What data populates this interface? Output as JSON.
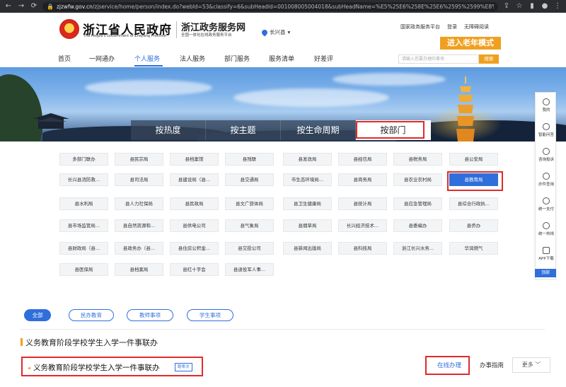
{
  "browser": {
    "url_host": "zjzwfw.gov.cn",
    "url_rest": "/zjservice/home/person/index.do?webId=53&classify=6&subHeadId=001008005004018&subHeadName=%E5%25E6%258E%25E6%2595%2599%E8%2582%25..."
  },
  "header": {
    "gov_title": "浙江省人民政府",
    "gov_subtitle": "The People's Government of Zhejiang Province",
    "svc_title": "浙江政务服务网",
    "svc_subtitle": "全国一体化在线政务服务平台",
    "region": "长兴县",
    "top_links": [
      "国家政务服务平台",
      "登录",
      "无障碍阅读"
    ],
    "elder_mode": "进入老年模式"
  },
  "nav": {
    "items": [
      "首页",
      "一网通办",
      "个人服务",
      "法人服务",
      "部门服务",
      "服务清单",
      "好差评"
    ],
    "active_index": 2,
    "search_placeholder": "请输入您要办理的事项",
    "search_button": "搜索"
  },
  "category_tabs": [
    "按热度",
    "按主题",
    "按生命周期",
    "按部门"
  ],
  "category_active_index": 3,
  "departments": [
    [
      "多部门联办",
      "县民宗局",
      "县档案馆",
      "县残联",
      "县发改局",
      "县经信局",
      "县税务局",
      "县公安局"
    ],
    [
      "长兴县消防救...",
      "县司法局",
      "县建设局（县...",
      "县交通局",
      "市生态环境局...",
      "县商务局",
      "县农业农村局",
      "县教育局"
    ],
    [
      "县水利局",
      "县人力社保局",
      "县民政局",
      "县文广旅体局",
      "县卫生健康局",
      "县统计局",
      "县应急管理局",
      "县综合行政执..."
    ],
    [
      "县市场监管局...",
      "县自然资源和...",
      "县供电公司",
      "县气象局",
      "县烟草局",
      "长兴经济技术...",
      "县委编办",
      "县侨办"
    ],
    [
      "县财政局（县...",
      "县政务办（县...",
      "县住房公积金...",
      "县交投公司",
      "县新闻出版局",
      "县科技局",
      "浙江长兴水务...",
      "华润燃气"
    ],
    [
      "县医保局",
      "县档案局",
      "县红十字会",
      "县退役军人事..."
    ]
  ],
  "selected_department": "县教育局",
  "sidebar": {
    "items": [
      "我的",
      "智能问答",
      "咨询投诉",
      "办件查询",
      "统一支付",
      "统一热线",
      "APP下载"
    ],
    "back": "顶部"
  },
  "filters": {
    "chips": [
      "全部",
      "民办教育",
      "教师事项",
      "学生事项"
    ],
    "active_index": 0
  },
  "section": {
    "title": "义务教育阶段学校学生入学一件事联办"
  },
  "item": {
    "title": "义务教育阶段学校学生入学一件事联办",
    "tag": "跑零次",
    "online_button": "在线办理",
    "guide_button": "办事指南",
    "more_button": "更多 ﹀"
  },
  "colors": {
    "accent": "#2f6fdc",
    "orange": "#f0a020",
    "highlight": "#e02a2a"
  }
}
